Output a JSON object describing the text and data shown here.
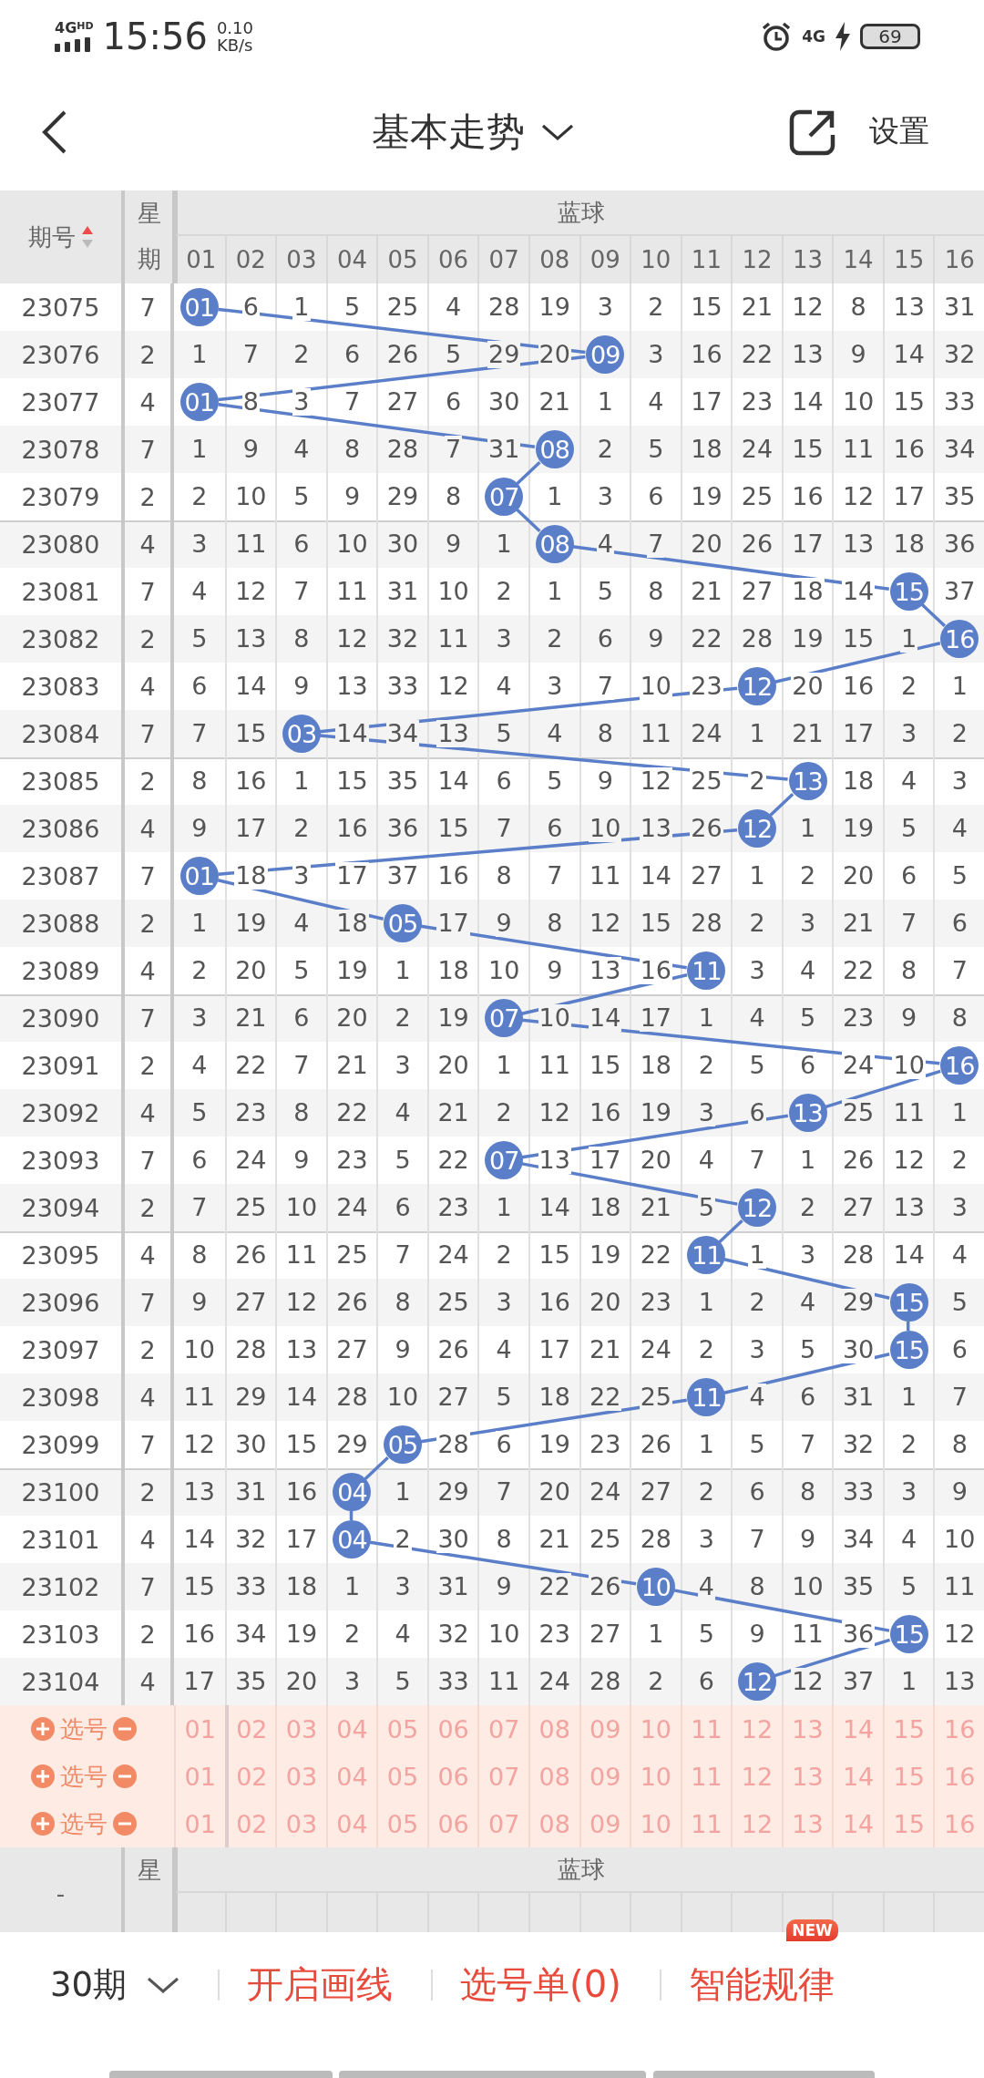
{
  "status_bar": {
    "network": "4G",
    "network_badge": "HD",
    "time": "15:56",
    "speed": "0.10",
    "speed_unit": "KB/s",
    "mobile": "4G",
    "battery": "69"
  },
  "nav": {
    "title": "基本走势",
    "settings": "设置"
  },
  "table": {
    "issue_header": "期号",
    "week_header": "星期",
    "group_header": "蓝球",
    "columns": [
      "01",
      "02",
      "03",
      "04",
      "05",
      "06",
      "07",
      "08",
      "09",
      "10",
      "11",
      "12",
      "13",
      "14",
      "15",
      "16"
    ],
    "rows": [
      {
        "issue": "23075",
        "week": "7",
        "n": [
          "01",
          "6",
          "1",
          "5",
          "25",
          "4",
          "28",
          "19",
          "3",
          "2",
          "15",
          "21",
          "12",
          "8",
          "13",
          "31"
        ],
        "hit": [
          true,
          false,
          false,
          false,
          false,
          false,
          false,
          false,
          false,
          false,
          false,
          false,
          false,
          false,
          false,
          false
        ]
      },
      {
        "issue": "23076",
        "week": "2",
        "n": [
          "1",
          "7",
          "2",
          "6",
          "26",
          "5",
          "29",
          "20",
          "09",
          "3",
          "16",
          "22",
          "13",
          "9",
          "14",
          "32"
        ],
        "hit": [
          false,
          false,
          false,
          false,
          false,
          false,
          false,
          false,
          true,
          false,
          false,
          false,
          false,
          false,
          false,
          false
        ]
      },
      {
        "issue": "23077",
        "week": "4",
        "n": [
          "01",
          "8",
          "3",
          "7",
          "27",
          "6",
          "30",
          "21",
          "1",
          "4",
          "17",
          "23",
          "14",
          "10",
          "15",
          "33"
        ],
        "hit": [
          true,
          false,
          false,
          false,
          false,
          false,
          false,
          false,
          false,
          false,
          false,
          false,
          false,
          false,
          false,
          false
        ]
      },
      {
        "issue": "23078",
        "week": "7",
        "n": [
          "1",
          "9",
          "4",
          "8",
          "28",
          "7",
          "31",
          "08",
          "2",
          "5",
          "18",
          "24",
          "15",
          "11",
          "16",
          "34"
        ],
        "hit": [
          false,
          false,
          false,
          false,
          false,
          false,
          false,
          true,
          false,
          false,
          false,
          false,
          false,
          false,
          false,
          false
        ]
      },
      {
        "issue": "23079",
        "week": "2",
        "n": [
          "2",
          "10",
          "5",
          "9",
          "29",
          "8",
          "07",
          "1",
          "3",
          "6",
          "19",
          "25",
          "16",
          "12",
          "17",
          "35"
        ],
        "hit": [
          false,
          false,
          false,
          false,
          false,
          false,
          true,
          false,
          false,
          false,
          false,
          false,
          false,
          false,
          false,
          false
        ]
      },
      {
        "issue": "23080",
        "week": "4",
        "n": [
          "3",
          "11",
          "6",
          "10",
          "30",
          "9",
          "1",
          "08",
          "4",
          "7",
          "20",
          "26",
          "17",
          "13",
          "18",
          "36"
        ],
        "hit": [
          false,
          false,
          false,
          false,
          false,
          false,
          false,
          true,
          false,
          false,
          false,
          false,
          false,
          false,
          false,
          false
        ]
      },
      {
        "issue": "23081",
        "week": "7",
        "n": [
          "4",
          "12",
          "7",
          "11",
          "31",
          "10",
          "2",
          "1",
          "5",
          "8",
          "21",
          "27",
          "18",
          "14",
          "15",
          "37"
        ],
        "hit": [
          false,
          false,
          false,
          false,
          false,
          false,
          false,
          false,
          false,
          false,
          false,
          false,
          false,
          false,
          true,
          false
        ]
      },
      {
        "issue": "23082",
        "week": "2",
        "n": [
          "5",
          "13",
          "8",
          "12",
          "32",
          "11",
          "3",
          "2",
          "6",
          "9",
          "22",
          "28",
          "19",
          "15",
          "1",
          "16"
        ],
        "hit": [
          false,
          false,
          false,
          false,
          false,
          false,
          false,
          false,
          false,
          false,
          false,
          false,
          false,
          false,
          false,
          true
        ]
      },
      {
        "issue": "23083",
        "week": "4",
        "n": [
          "6",
          "14",
          "9",
          "13",
          "33",
          "12",
          "4",
          "3",
          "7",
          "10",
          "23",
          "12",
          "20",
          "16",
          "2",
          "1"
        ],
        "hit": [
          false,
          false,
          false,
          false,
          false,
          false,
          false,
          false,
          false,
          false,
          false,
          true,
          false,
          false,
          false,
          false
        ]
      },
      {
        "issue": "23084",
        "week": "7",
        "n": [
          "7",
          "15",
          "03",
          "14",
          "34",
          "13",
          "5",
          "4",
          "8",
          "11",
          "24",
          "1",
          "21",
          "17",
          "3",
          "2"
        ],
        "hit": [
          false,
          false,
          true,
          false,
          false,
          false,
          false,
          false,
          false,
          false,
          false,
          false,
          false,
          false,
          false,
          false
        ]
      },
      {
        "issue": "23085",
        "week": "2",
        "n": [
          "8",
          "16",
          "1",
          "15",
          "35",
          "14",
          "6",
          "5",
          "9",
          "12",
          "25",
          "2",
          "13",
          "18",
          "4",
          "3"
        ],
        "hit": [
          false,
          false,
          false,
          false,
          false,
          false,
          false,
          false,
          false,
          false,
          false,
          false,
          true,
          false,
          false,
          false
        ]
      },
      {
        "issue": "23086",
        "week": "4",
        "n": [
          "9",
          "17",
          "2",
          "16",
          "36",
          "15",
          "7",
          "6",
          "10",
          "13",
          "26",
          "12",
          "1",
          "19",
          "5",
          "4"
        ],
        "hit": [
          false,
          false,
          false,
          false,
          false,
          false,
          false,
          false,
          false,
          false,
          false,
          true,
          false,
          false,
          false,
          false
        ]
      },
      {
        "issue": "23087",
        "week": "7",
        "n": [
          "01",
          "18",
          "3",
          "17",
          "37",
          "16",
          "8",
          "7",
          "11",
          "14",
          "27",
          "1",
          "2",
          "20",
          "6",
          "5"
        ],
        "hit": [
          true,
          false,
          false,
          false,
          false,
          false,
          false,
          false,
          false,
          false,
          false,
          false,
          false,
          false,
          false,
          false
        ]
      },
      {
        "issue": "23088",
        "week": "2",
        "n": [
          "1",
          "19",
          "4",
          "18",
          "05",
          "17",
          "9",
          "8",
          "12",
          "15",
          "28",
          "2",
          "3",
          "21",
          "7",
          "6"
        ],
        "hit": [
          false,
          false,
          false,
          false,
          true,
          false,
          false,
          false,
          false,
          false,
          false,
          false,
          false,
          false,
          false,
          false
        ]
      },
      {
        "issue": "23089",
        "week": "4",
        "n": [
          "2",
          "20",
          "5",
          "19",
          "1",
          "18",
          "10",
          "9",
          "13",
          "16",
          "11",
          "3",
          "4",
          "22",
          "8",
          "7"
        ],
        "hit": [
          false,
          false,
          false,
          false,
          false,
          false,
          false,
          false,
          false,
          false,
          true,
          false,
          false,
          false,
          false,
          false
        ]
      },
      {
        "issue": "23090",
        "week": "7",
        "n": [
          "3",
          "21",
          "6",
          "20",
          "2",
          "19",
          "07",
          "10",
          "14",
          "17",
          "1",
          "4",
          "5",
          "23",
          "9",
          "8"
        ],
        "hit": [
          false,
          false,
          false,
          false,
          false,
          false,
          true,
          false,
          false,
          false,
          false,
          false,
          false,
          false,
          false,
          false
        ]
      },
      {
        "issue": "23091",
        "week": "2",
        "n": [
          "4",
          "22",
          "7",
          "21",
          "3",
          "20",
          "1",
          "11",
          "15",
          "18",
          "2",
          "5",
          "6",
          "24",
          "10",
          "16"
        ],
        "hit": [
          false,
          false,
          false,
          false,
          false,
          false,
          false,
          false,
          false,
          false,
          false,
          false,
          false,
          false,
          false,
          true
        ]
      },
      {
        "issue": "23092",
        "week": "4",
        "n": [
          "5",
          "23",
          "8",
          "22",
          "4",
          "21",
          "2",
          "12",
          "16",
          "19",
          "3",
          "6",
          "13",
          "25",
          "11",
          "1"
        ],
        "hit": [
          false,
          false,
          false,
          false,
          false,
          false,
          false,
          false,
          false,
          false,
          false,
          false,
          true,
          false,
          false,
          false
        ]
      },
      {
        "issue": "23093",
        "week": "7",
        "n": [
          "6",
          "24",
          "9",
          "23",
          "5",
          "22",
          "07",
          "13",
          "17",
          "20",
          "4",
          "7",
          "1",
          "26",
          "12",
          "2"
        ],
        "hit": [
          false,
          false,
          false,
          false,
          false,
          false,
          true,
          false,
          false,
          false,
          false,
          false,
          false,
          false,
          false,
          false
        ]
      },
      {
        "issue": "23094",
        "week": "2",
        "n": [
          "7",
          "25",
          "10",
          "24",
          "6",
          "23",
          "1",
          "14",
          "18",
          "21",
          "5",
          "12",
          "2",
          "27",
          "13",
          "3"
        ],
        "hit": [
          false,
          false,
          false,
          false,
          false,
          false,
          false,
          false,
          false,
          false,
          false,
          true,
          false,
          false,
          false,
          false
        ]
      },
      {
        "issue": "23095",
        "week": "4",
        "n": [
          "8",
          "26",
          "11",
          "25",
          "7",
          "24",
          "2",
          "15",
          "19",
          "22",
          "11",
          "1",
          "3",
          "28",
          "14",
          "4"
        ],
        "hit": [
          false,
          false,
          false,
          false,
          false,
          false,
          false,
          false,
          false,
          false,
          true,
          false,
          false,
          false,
          false,
          false
        ]
      },
      {
        "issue": "23096",
        "week": "7",
        "n": [
          "9",
          "27",
          "12",
          "26",
          "8",
          "25",
          "3",
          "16",
          "20",
          "23",
          "1",
          "2",
          "4",
          "29",
          "15",
          "5"
        ],
        "hit": [
          false,
          false,
          false,
          false,
          false,
          false,
          false,
          false,
          false,
          false,
          false,
          false,
          false,
          false,
          true,
          false
        ]
      },
      {
        "issue": "23097",
        "week": "2",
        "n": [
          "10",
          "28",
          "13",
          "27",
          "9",
          "26",
          "4",
          "17",
          "21",
          "24",
          "2",
          "3",
          "5",
          "30",
          "15",
          "6"
        ],
        "hit": [
          false,
          false,
          false,
          false,
          false,
          false,
          false,
          false,
          false,
          false,
          false,
          false,
          false,
          false,
          true,
          false
        ]
      },
      {
        "issue": "23098",
        "week": "4",
        "n": [
          "11",
          "29",
          "14",
          "28",
          "10",
          "27",
          "5",
          "18",
          "22",
          "25",
          "11",
          "4",
          "6",
          "31",
          "1",
          "7"
        ],
        "hit": [
          false,
          false,
          false,
          false,
          false,
          false,
          false,
          false,
          false,
          false,
          true,
          false,
          false,
          false,
          false,
          false
        ]
      },
      {
        "issue": "23099",
        "week": "7",
        "n": [
          "12",
          "30",
          "15",
          "29",
          "05",
          "28",
          "6",
          "19",
          "23",
          "26",
          "1",
          "5",
          "7",
          "32",
          "2",
          "8"
        ],
        "hit": [
          false,
          false,
          false,
          false,
          true,
          false,
          false,
          false,
          false,
          false,
          false,
          false,
          false,
          false,
          false,
          false
        ]
      },
      {
        "issue": "23100",
        "week": "2",
        "n": [
          "13",
          "31",
          "16",
          "04",
          "1",
          "29",
          "7",
          "20",
          "24",
          "27",
          "2",
          "6",
          "8",
          "33",
          "3",
          "9"
        ],
        "hit": [
          false,
          false,
          false,
          true,
          false,
          false,
          false,
          false,
          false,
          false,
          false,
          false,
          false,
          false,
          false,
          false
        ]
      },
      {
        "issue": "23101",
        "week": "4",
        "n": [
          "14",
          "32",
          "17",
          "04",
          "2",
          "30",
          "8",
          "21",
          "25",
          "28",
          "3",
          "7",
          "9",
          "34",
          "4",
          "10"
        ],
        "hit": [
          false,
          false,
          false,
          true,
          false,
          false,
          false,
          false,
          false,
          false,
          false,
          false,
          false,
          false,
          false,
          false
        ]
      },
      {
        "issue": "23102",
        "week": "7",
        "n": [
          "15",
          "33",
          "18",
          "1",
          "3",
          "31",
          "9",
          "22",
          "26",
          "10",
          "4",
          "8",
          "10",
          "35",
          "5",
          "11"
        ],
        "hit": [
          false,
          false,
          false,
          false,
          false,
          false,
          false,
          false,
          false,
          true,
          false,
          false,
          false,
          false,
          false,
          false
        ]
      },
      {
        "issue": "23103",
        "week": "2",
        "n": [
          "16",
          "34",
          "19",
          "2",
          "4",
          "32",
          "10",
          "23",
          "27",
          "1",
          "5",
          "9",
          "11",
          "36",
          "15",
          "12"
        ],
        "hit": [
          false,
          false,
          false,
          false,
          false,
          false,
          false,
          false,
          false,
          false,
          false,
          false,
          false,
          false,
          true,
          false
        ]
      },
      {
        "issue": "23104",
        "week": "4",
        "n": [
          "17",
          "35",
          "20",
          "3",
          "5",
          "33",
          "11",
          "24",
          "28",
          "2",
          "6",
          "12",
          "12",
          "37",
          "1",
          "13"
        ],
        "hit": [
          false,
          false,
          false,
          false,
          false,
          false,
          false,
          false,
          false,
          false,
          false,
          true,
          false,
          false,
          false,
          false
        ]
      }
    ],
    "select_rows": [
      {
        "label": "选号",
        "numbers": [
          "01",
          "02",
          "03",
          "04",
          "05",
          "06",
          "07",
          "08",
          "09",
          "10",
          "11",
          "12",
          "13",
          "14",
          "15",
          "16"
        ]
      },
      {
        "label": "选号",
        "numbers": [
          "01",
          "02",
          "03",
          "04",
          "05",
          "06",
          "07",
          "08",
          "09",
          "10",
          "11",
          "12",
          "13",
          "14",
          "15",
          "16"
        ]
      },
      {
        "label": "选号",
        "numbers": [
          "01",
          "02",
          "03",
          "04",
          "05",
          "06",
          "07",
          "08",
          "09",
          "10",
          "11",
          "12",
          "13",
          "14",
          "15",
          "16"
        ]
      }
    ],
    "footer_header": {
      "issue_label": "-",
      "week_label": "星",
      "group_label": "蓝球"
    }
  },
  "bottom_bar": {
    "period": "30期",
    "actions": [
      {
        "label": "开启画线"
      },
      {
        "label": "选号单(0)"
      },
      {
        "label": "智能规律",
        "badge": "NEW"
      }
    ]
  }
}
